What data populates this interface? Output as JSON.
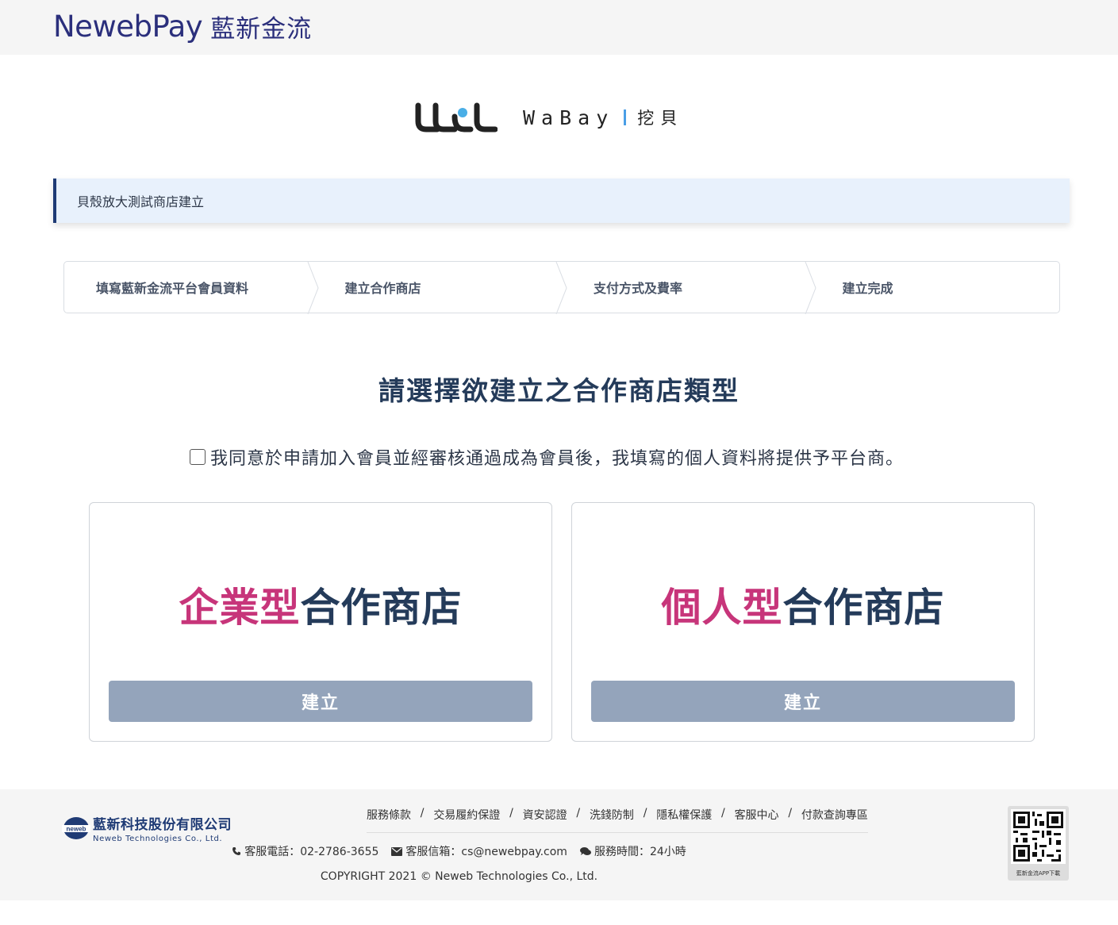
{
  "header": {
    "brand_en": "NewebPay",
    "brand_zh": "藍新金流"
  },
  "partner": {
    "name": "WaBay",
    "name_zh": "挖貝"
  },
  "notice": {
    "text": "貝殼放大測試商店建立"
  },
  "steps": [
    {
      "label": "填寫藍新金流平台會員資料"
    },
    {
      "label": "建立合作商店"
    },
    {
      "label": "支付方式及費率"
    },
    {
      "label": "建立完成"
    }
  ],
  "main": {
    "title": "請選擇欲建立之合作商店類型",
    "agree_text": "我同意於申請加入會員並經審核通過成為會員後，我填寫的個人資料將提供予平台商。",
    "cards": [
      {
        "highlight": "企業型",
        "rest": "合作商店",
        "button": "建立"
      },
      {
        "highlight": "個人型",
        "rest": "合作商店",
        "button": "建立"
      }
    ]
  },
  "footer": {
    "company_zh": "藍新科技股份有限公司",
    "company_en": "Neweb Technologies Co., Ltd.",
    "logo_text": "neweb",
    "links": [
      "服務條款",
      "交易履約保證",
      "資安認證",
      "洗錢防制",
      "隱私權保護",
      "客服中心",
      "付款查詢專區"
    ],
    "phone": "客服電話：02-2786-3655",
    "email": "客服信箱：cs@newebpay.com",
    "hours": "服務時間：24小時",
    "copyright": "COPYRIGHT 2021 © Neweb Technologies Co., Ltd.",
    "qr_caption": "藍新金流APP下載"
  },
  "colors": {
    "brand": "#2b2f7c",
    "highlight": "#c7357a",
    "button": "#94a4bb",
    "notice_bg": "#e8f1fc",
    "title": "#243b5a"
  }
}
